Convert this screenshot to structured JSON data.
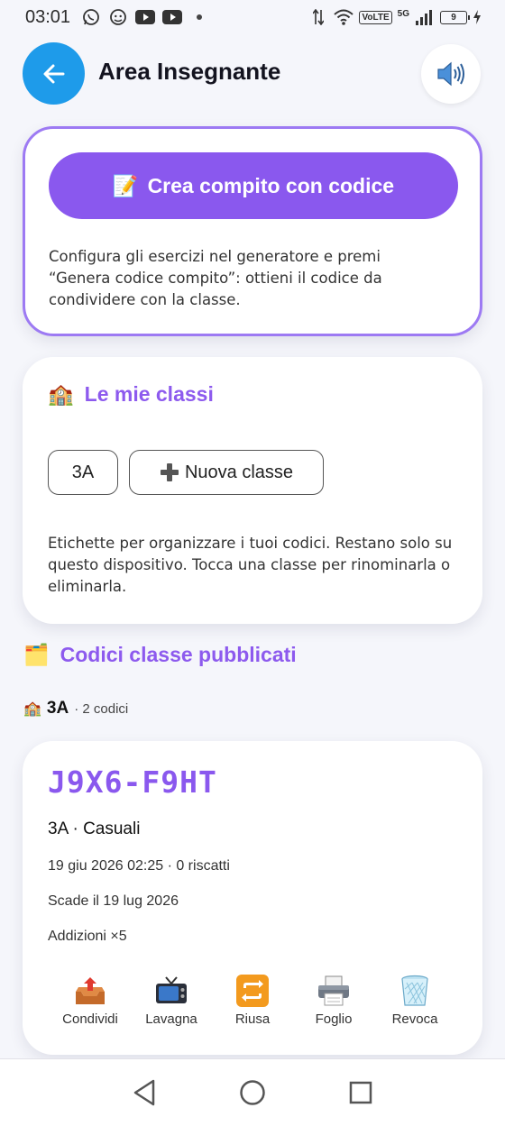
{
  "status_bar": {
    "time": "03:01",
    "network_label": "VoLTE",
    "network_gen": "5G",
    "battery": "9"
  },
  "header": {
    "title": "Area Insegnante"
  },
  "create_card": {
    "button_emoji": "📝",
    "button_label": "Crea compito con codice",
    "description": "Configura gli esercizi nel generatore e premi “Genera codice compito”: ottieni il codice da condividere con la classe."
  },
  "classes_card": {
    "emoji": "🏫",
    "title": "Le mie classi",
    "chips": [
      "3A"
    ],
    "new_class_label": "Nuova classe",
    "description": "Etichette per organizzare i tuoi codici. Restano solo su questo dispositivo. Tocca una classe per rinominarla o eliminarla."
  },
  "published": {
    "emoji": "🗂️",
    "title": "Codici classe pubblicati",
    "group": {
      "emoji": "🏫",
      "name": "3A",
      "count": "· 2 codici"
    },
    "code_card": {
      "code": "J9X6-F9HT",
      "title": "3A · Casuali",
      "created": "19 giu 2026 02:25 · 0 riscatti",
      "expires": "Scade il 19 lug 2026",
      "exercise": "Addizioni ×5",
      "actions": [
        {
          "label": "Condividi",
          "icon": "outbox-tray-icon"
        },
        {
          "label": "Lavagna",
          "icon": "television-icon"
        },
        {
          "label": "Riusa",
          "icon": "repeat-icon"
        },
        {
          "label": "Foglio",
          "icon": "printer-icon"
        },
        {
          "label": "Revoca",
          "icon": "wastebasket-icon"
        }
      ]
    }
  },
  "colors": {
    "accent": "#8a58ee",
    "back_button": "#1e9bea",
    "background": "#f5f6fb"
  }
}
